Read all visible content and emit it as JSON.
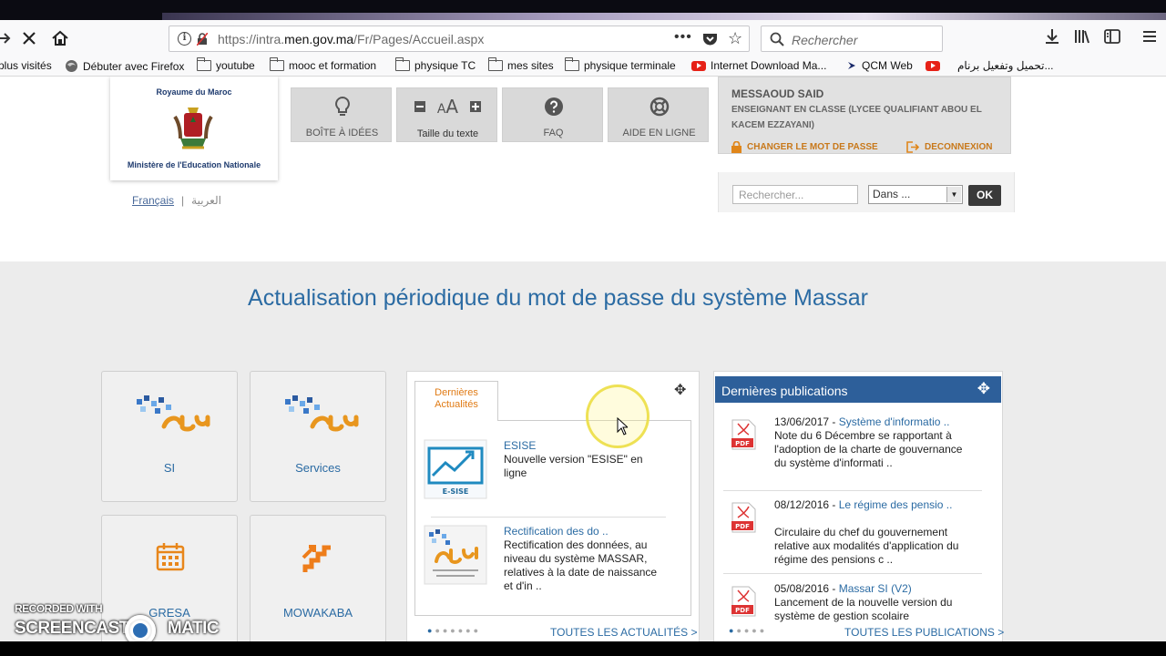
{
  "browser": {
    "url_prefix": "https://intra.",
    "url_domain": "men.gov.ma",
    "url_path": "/Fr/Pages/Accueil.aspx",
    "search_placeholder": "Rechercher",
    "bookmarks": [
      {
        "label": "plus visités",
        "icon": "none"
      },
      {
        "label": "Débuter avec Firefox",
        "icon": "firefox-icon"
      },
      {
        "label": "youtube",
        "icon": "folder-icon"
      },
      {
        "label": "mooc et formation",
        "icon": "folder-icon"
      },
      {
        "label": "physique TC",
        "icon": "folder-icon"
      },
      {
        "label": "mes sites",
        "icon": "folder-icon"
      },
      {
        "label": "physique terminale",
        "icon": "folder-icon"
      },
      {
        "label": "Internet Download Ma...",
        "icon": "youtube-icon"
      },
      {
        "label": "QCM Web",
        "icon": "arrow-icon"
      },
      {
        "label": "تحميل وتفعيل برنام...",
        "icon": "youtube-icon"
      }
    ]
  },
  "header": {
    "kingdom": "Royaume du Maroc",
    "ministry": "Ministère de l'Education Nationale",
    "lang_fr": "Français",
    "lang_sep": "|",
    "lang_ar": "العربية",
    "tools": {
      "ideas": "BOÎTE À IDÉES",
      "text_size": "Taille du texte",
      "faq": "FAQ",
      "help": "AIDE EN LIGNE"
    },
    "user": {
      "name": "MESSAOUD SAID",
      "role": "ENSEIGNANT EN CLASSE (LYCEE QUALIFIANT ABOU EL KACEM EZZAYANI)",
      "change_password": "CHANGER LE MOT DE PASSE",
      "logout": "DECONNEXION"
    },
    "search": {
      "placeholder": "Rechercher...",
      "scope": "Dans ...",
      "ok": "OK"
    }
  },
  "main": {
    "headline": "Actualisation périodique du mot de passe du système Massar",
    "apps": [
      {
        "label": "SI"
      },
      {
        "label": "Services"
      },
      {
        "label": "GRESA"
      },
      {
        "label": "MOWAKABA"
      }
    ],
    "news": {
      "tab": "Dernières Actualités",
      "items": [
        {
          "title": "ESISE",
          "desc": "Nouvelle version \"ESISE\" en ligne"
        },
        {
          "title": "Rectification des do ..",
          "desc": "Rectification des données, au niveau du système MASSAR, relatives à la date de naissance et d'in .."
        }
      ],
      "all_link": "TOUTES LES ACTUALITÉS >"
    },
    "publications": {
      "title": "Dernières publications",
      "items": [
        {
          "date": "13/06/2017 - ",
          "link": "Système d'informatio ..",
          "desc": "Note du 6 Décembre se rapportant à l'adoption de la charte de gouvernance du système d'informati .."
        },
        {
          "date": "08/12/2016 - ",
          "link": "Le régime des pensio ..",
          "desc": "Circulaire du chef du gouvernement relative aux modalités d'application du régime des pensions c .."
        },
        {
          "date": "05/08/2016 - ",
          "link": "Massar SI (V2)",
          "desc": "Lancement de la nouvelle version du système de gestion scolaire"
        }
      ],
      "all_link": "TOUTES LES PUBLICATIONS >"
    }
  },
  "watermark": {
    "recorded": "RECORDED WITH",
    "brand_left": "SCREENCAST",
    "brand_right": "MATIC"
  },
  "colors": {
    "accent_blue": "#2b6ba3",
    "accent_orange": "#e07b15",
    "header_blue": "#2d5f9a"
  }
}
